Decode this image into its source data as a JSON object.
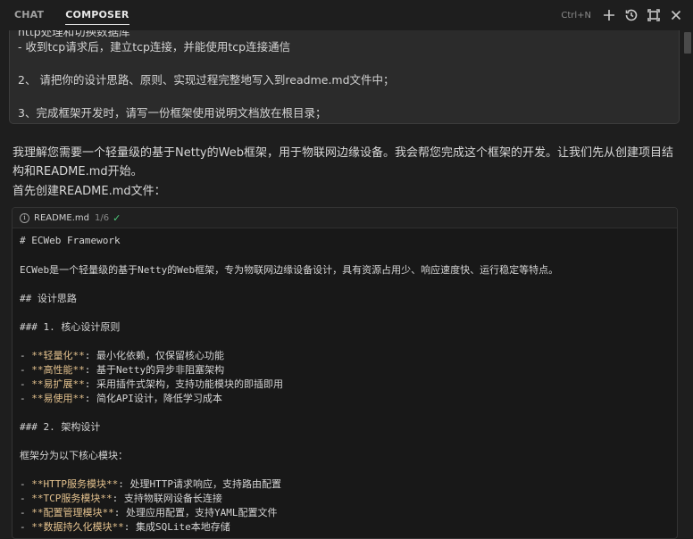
{
  "tabs": {
    "chat": "CHAT",
    "composer": "COMPOSER"
  },
  "top_actions": {
    "shortcut": "Ctrl+N",
    "icons": [
      "plus-icon",
      "history-icon",
      "maximize-icon",
      "close-icon"
    ]
  },
  "prompt": {
    "line_cut": "http处理和切换数据库",
    "line1": "- 收到tcp请求后，建立tcp连接，并能使用tcp连接通信",
    "line2": "2、 请把你的设计思路、原则、实现过程完整地写入到readme.md文件中；",
    "line3": "3、完成框架开发时，请写一份框架使用说明文档放在根目录；"
  },
  "response": {
    "p1": "我理解您需要一个轻量级的基于Netty的Web框架，用于物联网边缘设备。我会帮您完成这个框架的开发。让我们先从创建项目结构和README.md开始。",
    "p2": "首先创建README.md文件："
  },
  "code": {
    "filename": "README.md",
    "version": "1/6",
    "lines": {
      "l1": "# ECWeb Framework",
      "l2": "ECWeb是一个轻量级的基于Netty的Web框架，专为物联网边缘设备设计，具有资源占用少、响应速度快、运行稳定等特点。",
      "l3": "## 设计思路",
      "l4": "### 1. 核心设计原则",
      "l5_prefix": "- ",
      "l5_bold": "**轻量化**",
      "l5_rest": ": 最小化依赖，仅保留核心功能",
      "l6_prefix": "- ",
      "l6_bold": "**高性能**",
      "l6_rest": ": 基于Netty的异步非阻塞架构",
      "l7_prefix": "- ",
      "l7_bold": "**易扩展**",
      "l7_rest": ": 采用插件式架构，支持功能模块的即插即用",
      "l8_prefix": "- ",
      "l8_bold": "**易使用**",
      "l8_rest": ": 简化API设计，降低学习成本",
      "l9": "### 2. 架构设计",
      "l10": "框架分为以下核心模块：",
      "l11_prefix": "- ",
      "l11_bold": "**HTTP服务模块**",
      "l11_rest": ": 处理HTTP请求响应，支持路由配置",
      "l12_prefix": "- ",
      "l12_bold": "**TCP服务模块**",
      "l12_rest": ": 支持物联网设备长连接",
      "l13_prefix": "- ",
      "l13_bold": "**配置管理模块**",
      "l13_rest": ": 处理应用配置，支持YAML配置文件",
      "l14_prefix": "- ",
      "l14_bold": "**数据持久化模块**",
      "l14_rest": ": 集成SQLite本地存储"
    }
  },
  "colors": {
    "bg": "#1e1e1e",
    "bold_text": "#e2c08d",
    "check": "#4ec97a"
  }
}
